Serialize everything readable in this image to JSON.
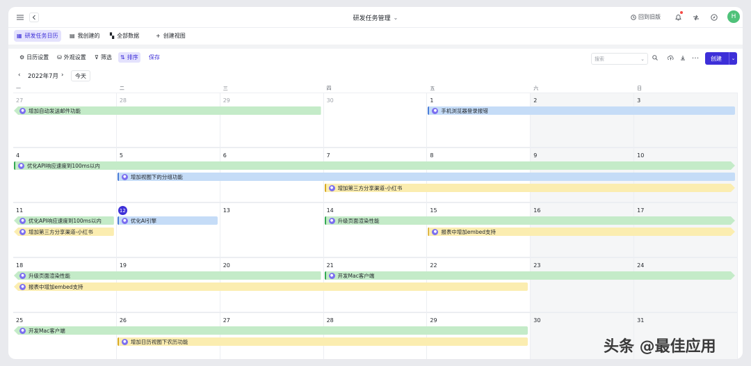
{
  "header": {
    "title": "研发任务管理",
    "back_old_label": "回到旧版",
    "avatar_initial": "H"
  },
  "tabs": [
    {
      "label": "研发任务日历",
      "icon": "calendar-icon",
      "active": true
    },
    {
      "label": "我创建的",
      "icon": "table-icon",
      "active": false
    },
    {
      "label": "全部数据",
      "icon": "grid-icon",
      "active": false
    },
    {
      "label": "创建视图",
      "icon": "plus-icon",
      "active": false
    }
  ],
  "toolbar": {
    "calendar_settings": "日历设置",
    "appearance_settings": "外观设置",
    "filter": "筛选",
    "sort": "排序",
    "save": "保存",
    "search_placeholder": "搜索",
    "create": "创建"
  },
  "month": {
    "label": "2022年7月",
    "today": "今天"
  },
  "weekdays": [
    "一",
    "二",
    "三",
    "四",
    "五",
    "六",
    "日"
  ],
  "weeks": [
    [
      "27",
      "28",
      "29",
      "30",
      "1",
      "2",
      "3"
    ],
    [
      "4",
      "5",
      "6",
      "7",
      "8",
      "9",
      "10"
    ],
    [
      "11",
      "12",
      "13",
      "14",
      "15",
      "16",
      "17"
    ],
    [
      "18",
      "19",
      "20",
      "21",
      "22",
      "23",
      "24"
    ],
    [
      "25",
      "26",
      "27",
      "28",
      "29",
      "30",
      "31"
    ]
  ],
  "today_date": "12",
  "events": [
    {
      "week": 0,
      "start": 0,
      "end": 2,
      "row": 0,
      "color": "green",
      "title": "增加自动发送邮件功能",
      "left": "arrow",
      "right": "flat"
    },
    {
      "week": 0,
      "start": 4,
      "end": 6,
      "row": 0,
      "color": "blue",
      "title": "手机浏览器登录报错",
      "left": "bar",
      "right": "flat"
    },
    {
      "week": 1,
      "start": 0,
      "end": 6,
      "row": 0,
      "color": "green",
      "title": "优化API响应速度到100ms以内",
      "left": "bar",
      "right": "arrow"
    },
    {
      "week": 1,
      "start": 1,
      "end": 6,
      "row": 1,
      "color": "blue",
      "title": "增加视图下的分组功能",
      "left": "bar",
      "right": "flat"
    },
    {
      "week": 1,
      "start": 3,
      "end": 6,
      "row": 2,
      "color": "yellow",
      "title": "增加第三方分享渠道-小红书",
      "left": "bar",
      "right": "arrow"
    },
    {
      "week": 2,
      "start": 0,
      "end": 0,
      "row": 0,
      "color": "green",
      "title": "优化API响应速度到100ms以内",
      "left": "arrow",
      "right": "flat"
    },
    {
      "week": 2,
      "start": 0,
      "end": 0,
      "row": 1,
      "color": "yellow",
      "title": "增加第三方分享渠道-小红书",
      "left": "arrow",
      "right": "flat"
    },
    {
      "week": 2,
      "start": 1,
      "end": 1,
      "row": 0,
      "color": "blue",
      "title": "优化AI引擎",
      "left": "bar",
      "right": "flat"
    },
    {
      "week": 2,
      "start": 3,
      "end": 6,
      "row": 0,
      "color": "green",
      "title": "升级页面渲染性能",
      "left": "bar",
      "right": "arrow"
    },
    {
      "week": 2,
      "start": 4,
      "end": 6,
      "row": 1,
      "color": "yellow",
      "title": "报表中增加embed支持",
      "left": "bar",
      "right": "arrow"
    },
    {
      "week": 3,
      "start": 0,
      "end": 2,
      "row": 0,
      "color": "green",
      "title": "升级页面渲染性能",
      "left": "arrow",
      "right": "flat"
    },
    {
      "week": 3,
      "start": 3,
      "end": 6,
      "row": 0,
      "color": "green",
      "title": "开发Mac客户端",
      "left": "bar",
      "right": "arrow"
    },
    {
      "week": 3,
      "start": 0,
      "end": 4,
      "row": 1,
      "color": "yellow",
      "title": "报表中增加embed支持",
      "left": "arrow",
      "right": "flat"
    },
    {
      "week": 4,
      "start": 0,
      "end": 4,
      "row": 0,
      "color": "green",
      "title": "开发Mac客户端",
      "left": "arrow",
      "right": "flat"
    },
    {
      "week": 4,
      "start": 1,
      "end": 4,
      "row": 1,
      "color": "yellow",
      "title": "增加日历视图下农历功能",
      "left": "bar",
      "right": "flat"
    }
  ],
  "watermark": "头条 @最佳应用"
}
